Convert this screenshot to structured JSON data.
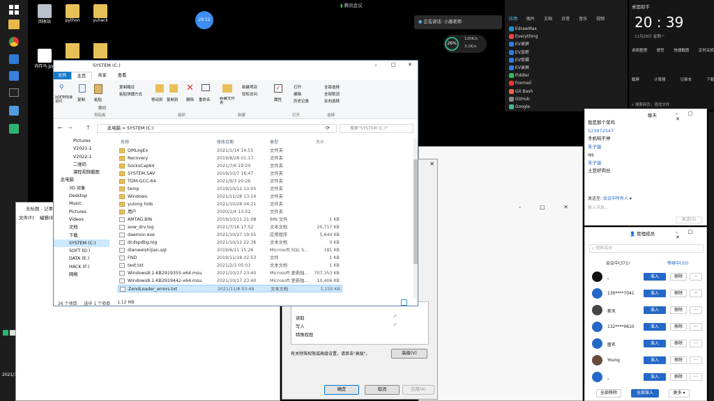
{
  "taskbar_left": {
    "icons": [
      "folder-icon",
      "chrome-icon",
      "pin-icon",
      "app-icon",
      "terminal-icon",
      "explorer-icon",
      "green-icon"
    ]
  },
  "desktop": {
    "icons": [
      {
        "label": "回收站"
      },
      {
        "label": "python"
      },
      {
        "label": "yuhack"
      }
    ],
    "file1_label": "内存马.jpg",
    "bubble": "29:12"
  },
  "top_meeting": "腾讯会议",
  "speaking": "正在讲话: 小唐老师",
  "net_widget": {
    "percent": "26%",
    "up": "120K/s",
    "down": "3.1K/s"
  },
  "apps_panel": {
    "tabs": [
      "应用",
      "图片",
      "文档",
      "日常",
      "音乐",
      "视频"
    ],
    "items": [
      "EdrawMax",
      "Everything",
      "EV录屏",
      "EV加密",
      "EV剪辑",
      "EV录屏",
      "Fiddler",
      "Foxmail",
      "Git Bash",
      "GitHub",
      "Google"
    ]
  },
  "clock": {
    "title": "桌面助手",
    "time": "20 : 39",
    "date": "11月29日 星期一",
    "actions": [
      "桌面整理",
      "便签",
      "快捷截图",
      "定时关机"
    ],
    "actions2": [
      "截屏",
      "计算器",
      "记事本",
      "下载"
    ],
    "search": "搜索网页，查找文件"
  },
  "explorer": {
    "title": "SYSTEM (C:)",
    "ribbon_tabs": [
      "文件",
      "主页",
      "共享",
      "查看"
    ],
    "ribbon_groups": [
      "剪贴板",
      "组织",
      "新建",
      "打开",
      "选择"
    ],
    "ribbon_items": [
      "固定到快速访问",
      "复制",
      "粘贴",
      "剪切",
      "复制路径",
      "粘贴快捷方式",
      "移动到",
      "复制到",
      "删除",
      "重命名",
      "新建文件夹",
      "新建项目",
      "轻松访问",
      "属性",
      "打开",
      "编辑",
      "历史记录",
      "全部选择",
      "全部取消",
      "反向选择"
    ],
    "address": [
      "此电脑",
      "SYSTEM (C:)"
    ],
    "search_placeholder": "搜索\"SYSTEM (C:)\"",
    "columns": [
      "名称",
      "修改日期",
      "类型",
      "大小"
    ],
    "nav": [
      "Pictures",
      "V2021-1",
      "V2022-1",
      "二维码",
      "课程视频截图",
      "此电脑",
      "3D 对象",
      "Desktop",
      "Music",
      "Pictures",
      "Videos",
      "文档",
      "下载",
      "SYSTEM (C:)",
      "SOFT (D:)",
      "DATA (E:)",
      "HACK (F:)",
      "网络"
    ],
    "files": [
      {
        "name": "QMLogEx",
        "date": "2021/1/14 14:55",
        "type": "文件夹",
        "size": ""
      },
      {
        "name": "Recovery",
        "date": "2019/8/28 01:17",
        "type": "文件夹",
        "size": ""
      },
      {
        "name": "SocksCap64",
        "date": "2021/7/6 19:20",
        "type": "文件夹",
        "size": ""
      },
      {
        "name": "SYSTEM.SAV",
        "date": "2019/10/7 16:47",
        "type": "文件夹",
        "size": ""
      },
      {
        "name": "TDM-GCC-64",
        "date": "2021/9/3 20:26",
        "type": "文件夹",
        "size": ""
      },
      {
        "name": "temp",
        "date": "2019/10/12 13:05",
        "type": "文件夹",
        "size": ""
      },
      {
        "name": "Windows",
        "date": "2021/11/28 13:14",
        "type": "文件夹",
        "size": ""
      },
      {
        "name": "yulong hids",
        "date": "2021/10/28 04:21",
        "type": "文件夹",
        "size": ""
      },
      {
        "name": "用户",
        "date": "2020/1/4 13:52",
        "type": "文件夹",
        "size": ""
      },
      {
        "name": "AMTAG.BIN",
        "date": "2019/10/11 21:08",
        "type": "BIN 文件",
        "size": "1 KB"
      },
      {
        "name": "aow_drv.log",
        "date": "2021/7/16 17:52",
        "type": "文本文档",
        "size": "20,717 KB"
      },
      {
        "name": "daemon.exe",
        "date": "2021/10/27 19:05",
        "type": "应用程序",
        "size": "5,644 KB"
      },
      {
        "name": "dcdspdbg.log",
        "date": "2021/10/11 22:36",
        "type": "文本文档",
        "size": "0 KB"
      },
      {
        "name": "dianweishijian.sql",
        "date": "2019/6/11 15:26",
        "type": "Microsoft SQL S...",
        "size": "181 KB"
      },
      {
        "name": "FND",
        "date": "2019/11/18 02:53",
        "type": "文件",
        "size": "1 KB"
      },
      {
        "name": "test.txt",
        "date": "2021/2/3 05:03",
        "type": "文本文档",
        "size": "1 KB"
      },
      {
        "name": "Windows8.1-KB2919355-x64.msu",
        "date": "2021/10/17 23:40",
        "type": "Microsoft 更新独...",
        "size": "707,353 KB"
      },
      {
        "name": "Windows8.1-KB2919442-x64.msu",
        "date": "2021/10/17 23:40",
        "type": "Microsoft 更新独...",
        "size": "10,406 KB"
      },
      {
        "name": "ZendLoader_errors.txt",
        "date": "2021/11/8 03:49",
        "type": "文本文档",
        "size": "1,150 KB"
      }
    ],
    "status": {
      "count": "26 个项目",
      "selected": "选中 1 个项目",
      "size": "1.12 MB"
    }
  },
  "notepad": {
    "title": "无标题 - 记事本",
    "menu": [
      "文件(F)",
      "编辑(E)"
    ]
  },
  "props": {
    "perm_rows": [
      "读取",
      "写入",
      "特殊权限"
    ],
    "advanced_note": "有关特殊权限或高级设置，请单击\"高级\"。",
    "advanced_btn": "高级(V)",
    "buttons": [
      "确定",
      "取消",
      "应用(A)"
    ]
  },
  "chat": {
    "title": "聊天",
    "messages": [
      {
        "text": "我是那个菜鸡",
        "kind": "msg"
      },
      {
        "text": "523972547",
        "kind": "user"
      },
      {
        "text": "手机响不停",
        "kind": "msg"
      },
      {
        "text": "朱子骏",
        "kind": "user"
      },
      {
        "text": "qq",
        "kind": "msg"
      },
      {
        "text": "朱子骏",
        "kind": "user"
      },
      {
        "text": "土豆好肉丝",
        "kind": "msg"
      }
    ],
    "send_to_label": "发送至:",
    "send_to": "会议中所有人",
    "input_placeholder": "输入消息...",
    "send_btn": "发送(S)"
  },
  "members": {
    "title": "管理成员",
    "search": "搜索成员",
    "tabs": [
      "会议中(371)",
      "等候中(10)"
    ],
    "list": [
      {
        "name": "。",
        "avatar": "#111111"
      },
      {
        "name": "130****7041",
        "avatar": "#2468c8"
      },
      {
        "name": "斯天",
        "avatar": "#444444"
      },
      {
        "name": "132****0610",
        "avatar": "#2468c8"
      },
      {
        "name": "匿名",
        "avatar": "#2468c8"
      },
      {
        "name": "Young",
        "avatar": "#6a4a3a"
      },
      {
        "name": "。",
        "avatar": "#2468c8"
      }
    ],
    "admit": "准入",
    "remove": "移除",
    "more": "···",
    "footer": [
      "全部移除",
      "全部准入",
      "更多"
    ]
  },
  "left_taskbar_bottom": {
    "date": "2021/11/29"
  }
}
